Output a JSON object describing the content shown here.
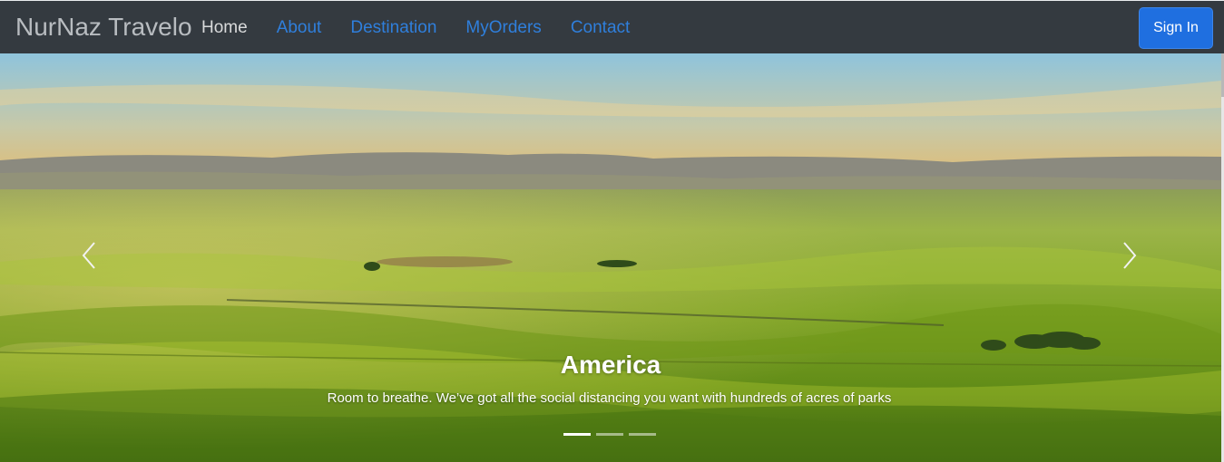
{
  "navbar": {
    "brand": "NurNaz Travelo",
    "links": [
      {
        "label": "Home",
        "active": true
      },
      {
        "label": "About",
        "active": false
      },
      {
        "label": "Destination",
        "active": false
      },
      {
        "label": "MyOrders",
        "active": false
      },
      {
        "label": "Contact",
        "active": false
      }
    ],
    "signin_label": "Sign In",
    "colors": {
      "background": "#343a40",
      "link": "#2f7fdc",
      "active_link": "#d9dadb",
      "signin": "#1f6fe0"
    }
  },
  "carousel": {
    "slide": {
      "title": "America",
      "text": "Room to breathe. We’ve got all the social distancing you want with hundreds of acres of parks",
      "image": "rolling-green-hills-sunset"
    },
    "indicators_count": 3,
    "active_index": 0,
    "prev_icon": "chevron-left-icon",
    "next_icon": "chevron-right-icon"
  }
}
